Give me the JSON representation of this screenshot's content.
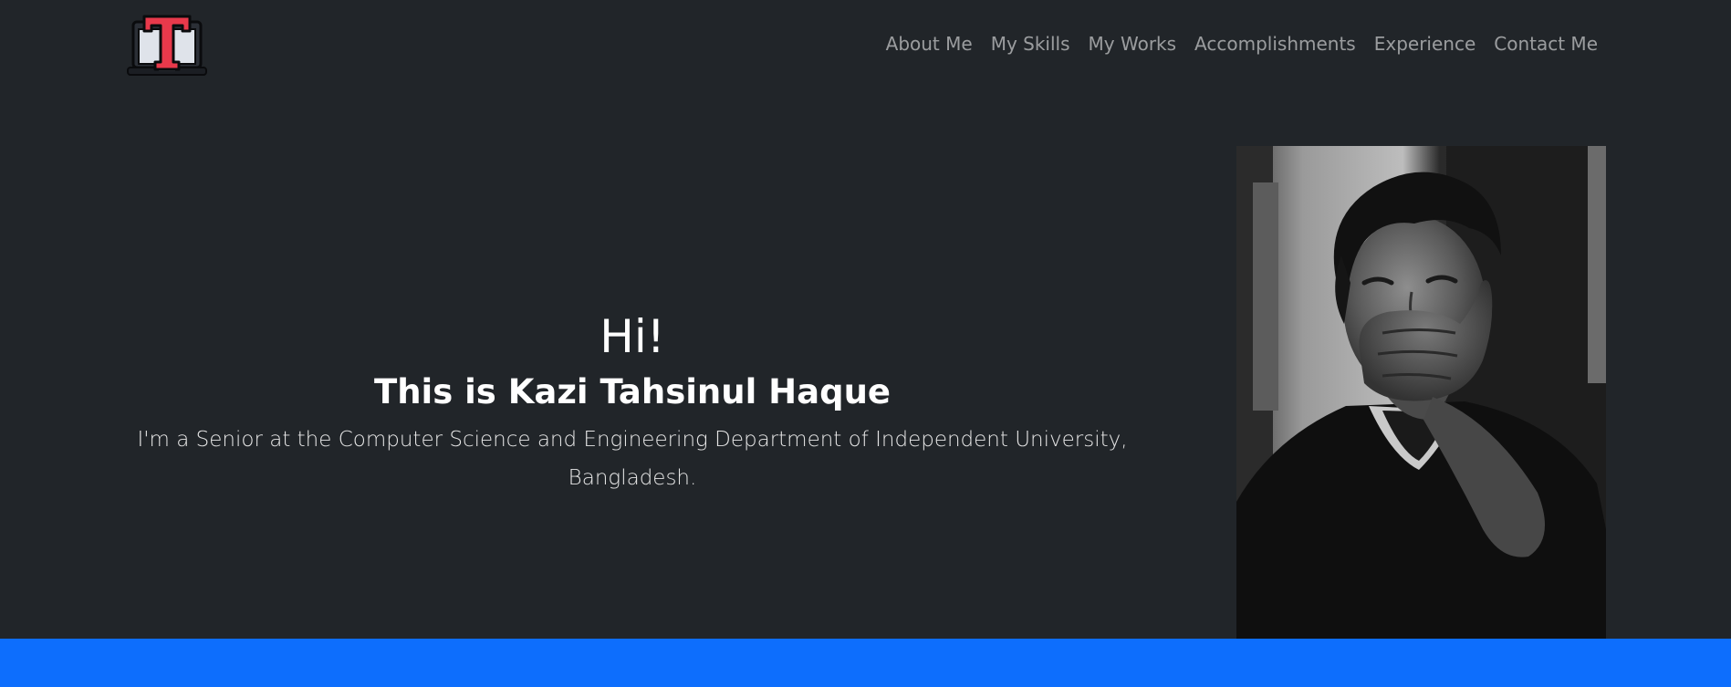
{
  "nav": {
    "items": [
      {
        "label": "About Me"
      },
      {
        "label": "My Skills"
      },
      {
        "label": "My Works"
      },
      {
        "label": "Accomplishments"
      },
      {
        "label": "Experience"
      },
      {
        "label": "Contact Me"
      }
    ]
  },
  "logo": {
    "letter": "T",
    "icon": "laptop-logo-icon"
  },
  "hero": {
    "greeting": "Hi!",
    "name": "This is Kazi Tahsinul Haque",
    "description": "I'm a Senior at the Computer Science and Engineering Department of Independent University, Bangladesh."
  },
  "photo": {
    "subject": "profile-photo",
    "style": "black-and-white portrait"
  },
  "colors": {
    "background": "#212529",
    "nav_text": "#8c8f93",
    "hero_text": "#ffffff",
    "accent_bar": "#0d6efd",
    "logo_red": "#e8394b"
  }
}
